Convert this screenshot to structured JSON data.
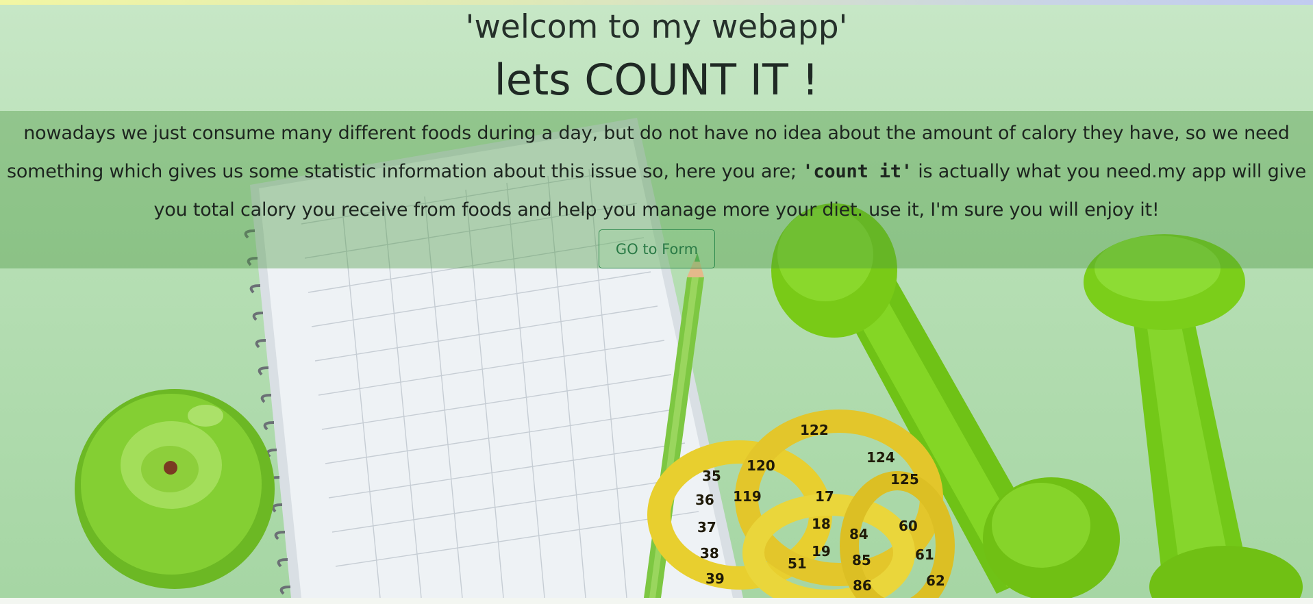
{
  "header": {
    "welcome": "'welcom to my webapp'",
    "tagline": "lets COUNT IT !"
  },
  "intro": {
    "before_bold": "nowadays we just consume many different foods during a day, but do not have no idea about the amount of calory they have, so we need something which gives us some statistic information about this issue so, here you are; ",
    "bold": "'count it'",
    "after_bold": " is actually what you need.my app will give you total calory you receive from foods and help you manage more your diet. use it, I'm sure you will enjoy it!"
  },
  "actions": {
    "go_to_form_label": "GO to Form"
  },
  "colors": {
    "background": "#a9d9ab",
    "button_outline": "#2f8a4e",
    "apple": "#7ac42a",
    "dumbbell": "#76cc12",
    "tape": "#e8cf2f"
  },
  "background_image": {
    "items": [
      "apple-icon",
      "notebook-icon",
      "pencil-icon",
      "measuring-tape-icon",
      "dumbbell-icon"
    ],
    "tape_numbers": [
      "35",
      "36",
      "37",
      "38",
      "39",
      "120",
      "119",
      "18",
      "19",
      "51",
      "84",
      "85",
      "86",
      "60",
      "61",
      "62",
      "125",
      "124",
      "17",
      "122"
    ]
  }
}
